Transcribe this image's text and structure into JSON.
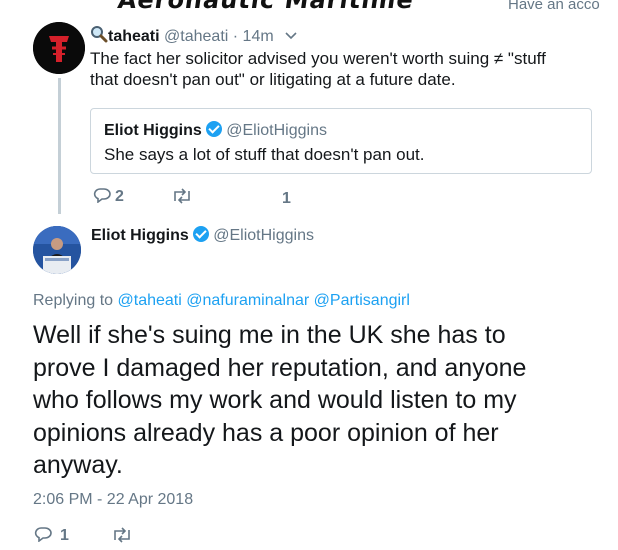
{
  "banner": {
    "art_text": "Aeronautic Maritime",
    "right_text": "Have an acco"
  },
  "parent_tweet": {
    "display_name": "taheati",
    "handle": "@taheati",
    "separator": "·",
    "time": "14m",
    "text_line1": "The fact her solicitor advised you weren't worth suing ≠ \"stuff",
    "text_line2": "that doesn't pan out\" or litigating at a future date.",
    "quoted": {
      "display_name": "Eliot Higgins",
      "handle": "@EliotHiggins",
      "text": "She says a lot of stuff that doesn't pan out."
    },
    "reply_count": "2",
    "like_count": "1"
  },
  "main_tweet": {
    "display_name": "Eliot Higgins",
    "handle": "@EliotHiggins",
    "replying_prefix": "Replying to",
    "reply_to": [
      "@taheati",
      "@nafuraminalnar",
      "@Partisangirl"
    ],
    "text_lines": [
      "Well if she's suing me in the UK she has to",
      "prove I damaged her reputation, and anyone",
      "who follows my work and would listen to my",
      "opinions already has a poor opinion of her",
      "anyway."
    ],
    "timestamp": "2:06 PM - 22 Apr 2018",
    "reply_count": "1"
  },
  "colors": {
    "link": "#1da1f2",
    "secondary_text": "#657786",
    "primary_text": "#14171a"
  }
}
